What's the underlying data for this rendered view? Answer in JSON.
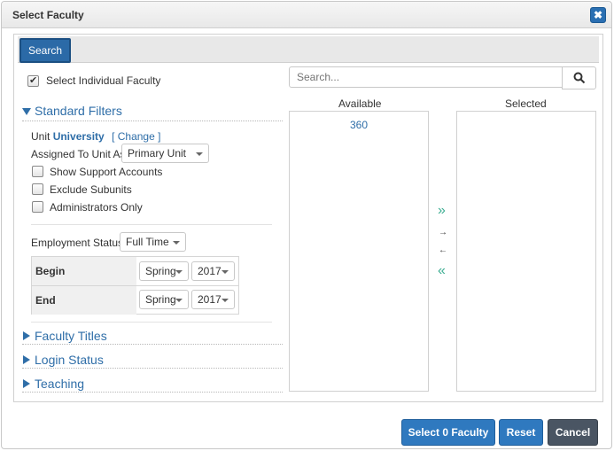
{
  "dialog": {
    "title": "Select Faculty",
    "close": "✖"
  },
  "tabs": [
    {
      "label": "Search"
    }
  ],
  "filters": {
    "select_individual": "Select Individual Faculty",
    "standard_filters": "Standard Filters",
    "unit_label": "Unit",
    "unit_value": "University",
    "change_link": "[ Change ]",
    "assigned_label": "Assigned To Unit As",
    "assigned_value": "Primary Unit",
    "show_support": "Show Support Accounts",
    "exclude_subunits": "Exclude Subunits",
    "admins_only": "Administrators Only",
    "employment_label": "Employment Status",
    "employment_value": "Full Time",
    "begin_label": "Begin",
    "end_label": "End",
    "begin_term": "Spring",
    "begin_year": "2017",
    "end_term": "Spring",
    "end_year": "2017",
    "faculty_titles": "Faculty Titles",
    "login_status": "Login Status",
    "teaching": "Teaching"
  },
  "search": {
    "placeholder": "Search..."
  },
  "lists": {
    "available_header": "Available",
    "selected_header": "Selected",
    "available_items": [
      "360"
    ]
  },
  "transfer": {
    "add_all": "»",
    "add_one": "→",
    "remove_one": "←",
    "remove_all": "«"
  },
  "footer": {
    "select_button": "Select 0 Faculty",
    "reset_button": "Reset",
    "cancel_button": "Cancel"
  }
}
